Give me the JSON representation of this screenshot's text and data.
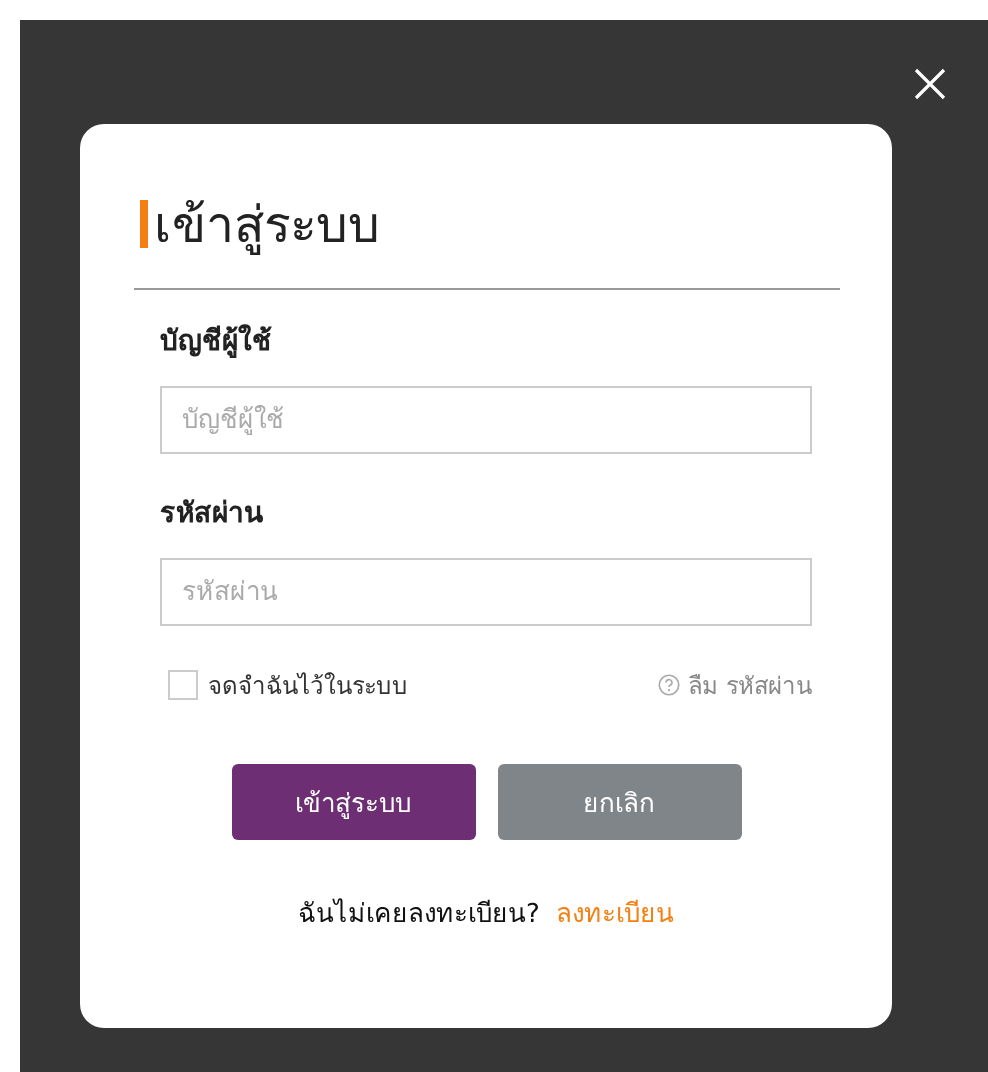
{
  "dialog": {
    "title": "เข้าสู่ระบบ",
    "fields": [
      {
        "label": "บัญชีผู้ใช้",
        "placeholder": "บัญชีผู้ใช้"
      },
      {
        "label": "รหัสผ่าน",
        "placeholder": "รหัสผ่าน"
      }
    ],
    "remember": {
      "label": "จดจำฉันไว้ในระบบ",
      "checked": false
    },
    "forgot": "ลืม รหัสผ่าน",
    "buttons": [
      {
        "label": "เข้าสู่ระบบ",
        "kind": "primary"
      },
      {
        "label": "ยกเลิก",
        "kind": "secondary"
      }
    ],
    "register": {
      "prompt": "ฉันไม่เคยลงทะเบียน?",
      "link": "ลงทะเบียน"
    }
  }
}
